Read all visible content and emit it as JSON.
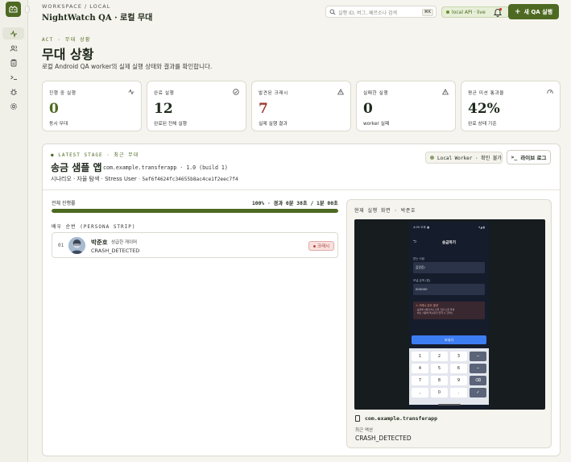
{
  "header": {
    "breadcrumb": "WORKSPACE / LOCAL",
    "title": "NightWatch QA · 로컬 무대",
    "search_placeholder": "실행 ID, 버그, 페르소나 검색",
    "search_shortcut": "⌘K",
    "api_status": "local API · live",
    "new_run_button": "새 QA 실행"
  },
  "page": {
    "eyebrow": "ACT · 무대 상황",
    "title": "무대 상황",
    "subtitle": "로컬 Android QA worker의 실제 실행 상태와 결과를 확인합니다."
  },
  "stats": [
    {
      "label": "진행 중 실행",
      "value": "0",
      "caption": "동시 무대",
      "icon": "activity-icon",
      "color": "#4e6a22"
    },
    {
      "label": "완료 실행",
      "value": "12",
      "caption": "완료된 전체 실행",
      "icon": "check-circle-icon",
      "color": "#1d2619"
    },
    {
      "label": "발견된 크래시",
      "value": "7",
      "caption": "실제 실행 결과",
      "icon": "warning-icon",
      "color": "#9a3b2f"
    },
    {
      "label": "실패한 실행",
      "value": "0",
      "caption": "worker 실패",
      "icon": "warning-icon",
      "color": "#1d2619"
    },
    {
      "label": "평균 미션 통과율",
      "value": "42%",
      "caption": "완료 상태 기준",
      "icon": "gauge-icon",
      "color": "#1d2619"
    }
  ],
  "stage": {
    "eyebrow": "LATEST STAGE · 최근 무대",
    "app_name": "송금 샘플 앱",
    "package_version": "com.example.transferapp · 1.0 (build 1)",
    "scenario": "시나리오 · 자율 탐색 · Stress User",
    "run_id": "5ef6f4624fc34655b8ac4ce1f2eec7f4",
    "worker_status": "Local Worker · 확인 불가",
    "live_log_button": "라이브 로그",
    "progress_label": "전체 진행률",
    "progress_summary": "100% · 경과 0분 38초 / 1분 00초",
    "progress_fraction": 1.0,
    "actor_order_label": "배우 순번 (PERSONA STRIP)",
    "actors": [
      {
        "index": "01",
        "name": "박준호",
        "role": "성급한 게이머",
        "status": "CRASH_DETECTED",
        "badge": "크래시"
      }
    ],
    "screen": {
      "label": "현재 실행 화면 · 박준호",
      "package": "com.example.transferapp",
      "recent_action_label": "최근 액션",
      "recent_action_value": "CRASH_DETECTED"
    }
  },
  "device": {
    "status_time": "4:09 오후 ▣",
    "status_right": "▾◢ ▮",
    "screen_title": "송금하기",
    "field1_label": "받는 사람",
    "field1_value": "김민준/",
    "field2_label": "보낼 금액 (원)",
    "field2_value": "000000",
    "warning_title": "⚠ 크래시 유도 옵션",
    "warning_line1": "· 송금액 0원이거나 너무 크면 오류 발생",
    "warning_line2": "· 받는 사람에 특수문자 입력 시 크래시",
    "send_button": "보내기",
    "keys": [
      "1",
      "2",
      "3",
      "−",
      "4",
      "5",
      "6",
      "⌣",
      "7",
      "8",
      "9",
      "⌫",
      ",",
      "0",
      ".",
      "✓"
    ]
  }
}
